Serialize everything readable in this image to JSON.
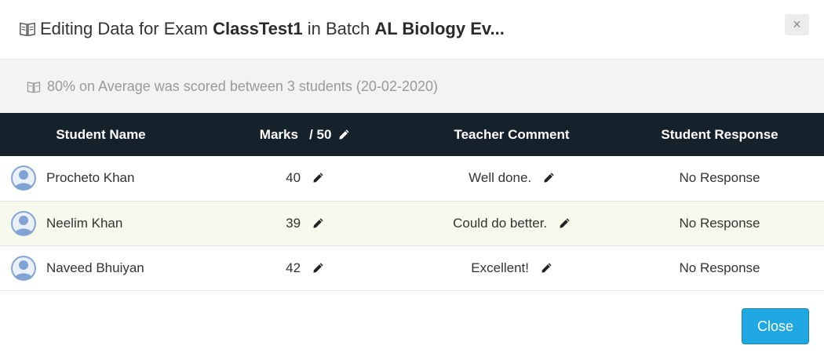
{
  "header": {
    "title_prefix": "Editing Data for Exam ",
    "exam_name": "ClassTest1",
    "title_middle": " in Batch ",
    "batch_name": "AL Biology Ev...",
    "close_symbol": "×",
    "icon": "book-icon"
  },
  "info": {
    "text": "80% on Average was scored between 3 students (20-02-2020)",
    "icon": "book-icon"
  },
  "table": {
    "headers": {
      "student_name": "Student Name",
      "marks_label": "Marks",
      "marks_total": "/ 50",
      "teacher_comment": "Teacher Comment",
      "student_response": "Student Response"
    },
    "rows": [
      {
        "name": "Procheto Khan",
        "marks": "40",
        "comment": "Well done.",
        "response": "No Response"
      },
      {
        "name": "Neelim Khan",
        "marks": "39",
        "comment": "Could do better.",
        "response": "No Response"
      },
      {
        "name": "Naveed Bhuiyan",
        "marks": "42",
        "comment": "Excellent!",
        "response": "No Response"
      }
    ]
  },
  "footer": {
    "close_label": "Close"
  },
  "colors": {
    "header_bg": "#15212b",
    "alt_row_bg": "#f6f9ec",
    "info_bg": "#f3f3f3",
    "primary_button": "#1ea7e0"
  }
}
